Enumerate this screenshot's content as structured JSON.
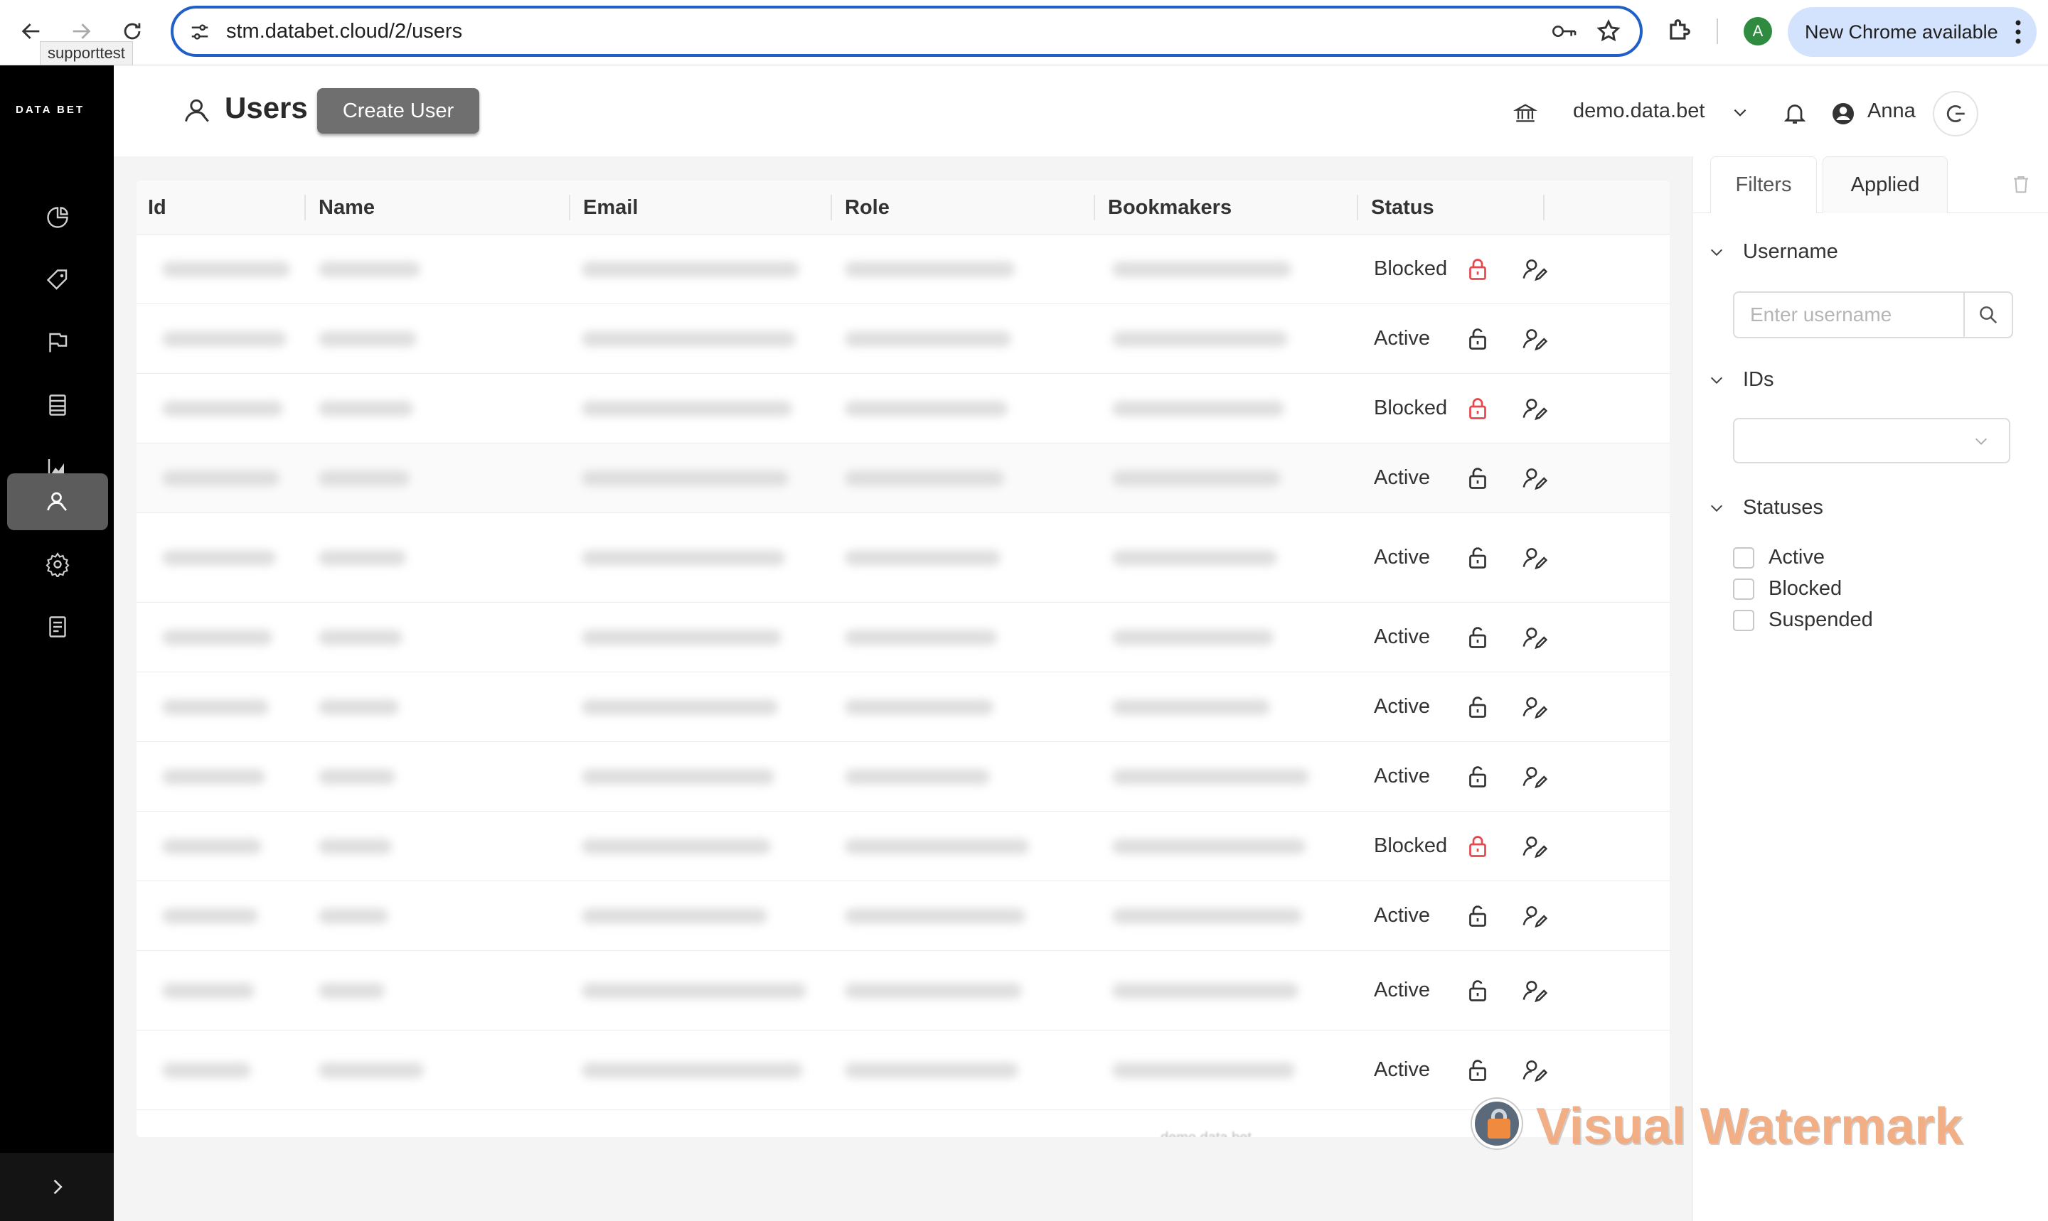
{
  "browser": {
    "url": "stm.databet.cloud/2/users",
    "tooltip": "supporttest",
    "profile_initial": "A",
    "update_label": "New Chrome available"
  },
  "sidebar": {
    "logo": "DATA BET",
    "items": [
      {
        "icon": "pie-chart-icon"
      },
      {
        "icon": "tag-icon"
      },
      {
        "icon": "flag-icon"
      },
      {
        "icon": "list-icon"
      },
      {
        "icon": "area-chart-icon"
      },
      {
        "icon": "users-icon",
        "active": true
      },
      {
        "icon": "gear-icon"
      },
      {
        "icon": "report-icon"
      }
    ]
  },
  "header": {
    "title": "Users",
    "create_button": "Create User",
    "company": "demo.data.bet",
    "user_name": "Anna"
  },
  "table": {
    "columns": [
      "Id",
      "Name",
      "Email",
      "Role",
      "Bookmakers",
      "Status"
    ],
    "rows": [
      {
        "status": "Blocked"
      },
      {
        "status": "Active"
      },
      {
        "status": "Blocked"
      },
      {
        "status": "Active"
      },
      {
        "status": "Active"
      },
      {
        "status": "Active"
      },
      {
        "status": "Active"
      },
      {
        "status": "Active"
      },
      {
        "status": "Blocked"
      },
      {
        "status": "Active"
      },
      {
        "status": "Active"
      },
      {
        "status": "Active"
      }
    ],
    "footer_text": "demo.data.bet"
  },
  "filters": {
    "tabs": [
      "Filters",
      "Applied"
    ],
    "username_section": "Username",
    "username_placeholder": "Enter username",
    "ids_section": "IDs",
    "statuses_section": "Statuses",
    "statuses": [
      "Active",
      "Blocked",
      "Suspended"
    ]
  },
  "watermark": {
    "text": "Visual Watermark"
  },
  "colors": {
    "blocked_lock": "#e5484d",
    "sidebar_bg": "#000000",
    "active_nav": "#5c5c5c",
    "create_button": "#6f6f6f",
    "omnibox_border": "#1f5fc7",
    "update_chip": "#d3e3fd"
  }
}
